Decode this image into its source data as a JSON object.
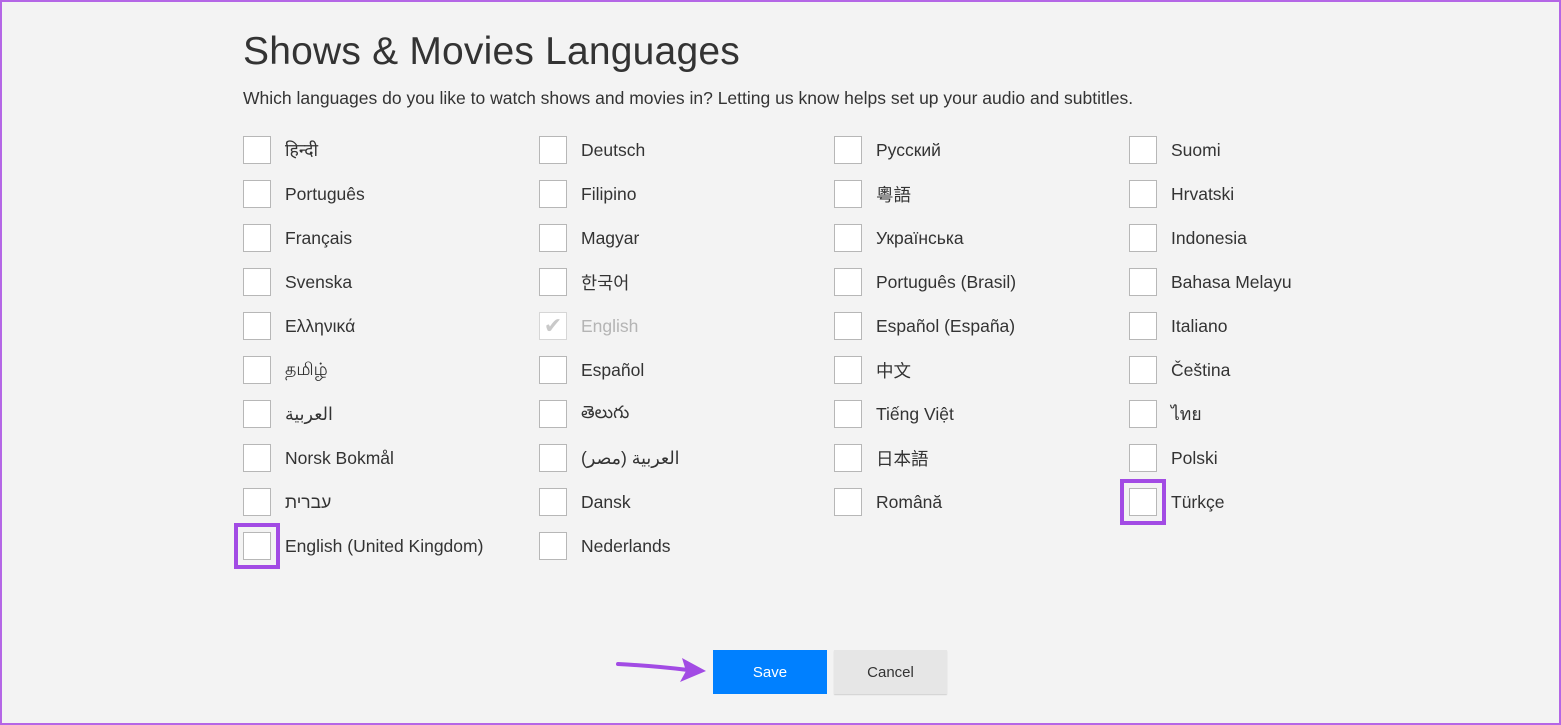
{
  "header": {
    "title": "Shows & Movies Languages",
    "subtitle": "Which languages do you like to watch shows and movies in? Letting us know helps set up your audio and subtitles."
  },
  "languages": {
    "col1": [
      {
        "label": "हिन्दी",
        "checked": false
      },
      {
        "label": "Português",
        "checked": false
      },
      {
        "label": "Français",
        "checked": false
      },
      {
        "label": "Svenska",
        "checked": false
      },
      {
        "label": "Ελληνικά",
        "checked": false
      },
      {
        "label": "தமிழ்",
        "checked": false
      },
      {
        "label": "العربية",
        "checked": false
      },
      {
        "label": "Norsk Bokmål",
        "checked": false
      },
      {
        "label": "עברית",
        "checked": false
      },
      {
        "label": "English (United Kingdom)",
        "checked": false,
        "highlighted": true
      }
    ],
    "col2": [
      {
        "label": "Deutsch",
        "checked": false
      },
      {
        "label": "Filipino",
        "checked": false
      },
      {
        "label": "Magyar",
        "checked": false
      },
      {
        "label": "한국어",
        "checked": false
      },
      {
        "label": "English",
        "checked": true,
        "disabled": true
      },
      {
        "label": "Español",
        "checked": false
      },
      {
        "label": "తెలుగు",
        "checked": false
      },
      {
        "label": "العربية (مصر)",
        "checked": false
      },
      {
        "label": "Dansk",
        "checked": false
      },
      {
        "label": "Nederlands",
        "checked": false
      }
    ],
    "col3": [
      {
        "label": "Русский",
        "checked": false
      },
      {
        "label": "粵語",
        "checked": false
      },
      {
        "label": "Українська",
        "checked": false
      },
      {
        "label": "Português (Brasil)",
        "checked": false
      },
      {
        "label": "Español (España)",
        "checked": false
      },
      {
        "label": "中文",
        "checked": false
      },
      {
        "label": "Tiếng Việt",
        "checked": false
      },
      {
        "label": "日本語",
        "checked": false
      },
      {
        "label": "Română",
        "checked": false
      }
    ],
    "col4": [
      {
        "label": "Suomi",
        "checked": false
      },
      {
        "label": "Hrvatski",
        "checked": false
      },
      {
        "label": "Indonesia",
        "checked": false
      },
      {
        "label": "Bahasa Melayu",
        "checked": false
      },
      {
        "label": "Italiano",
        "checked": false
      },
      {
        "label": "Čeština",
        "checked": false
      },
      {
        "label": "ไทย",
        "checked": false
      },
      {
        "label": "Polski",
        "checked": false
      },
      {
        "label": "Türkçe",
        "checked": false,
        "highlighted": true
      }
    ]
  },
  "actions": {
    "save_label": "Save",
    "cancel_label": "Cancel"
  },
  "colors": {
    "accent_highlight": "#a24be4",
    "save_button": "#0080ff",
    "cancel_button": "#e6e6e6",
    "background": "#f3f3f3"
  },
  "icons": {
    "check": "check-icon",
    "pointer_arrow": "arrow-right-icon"
  }
}
